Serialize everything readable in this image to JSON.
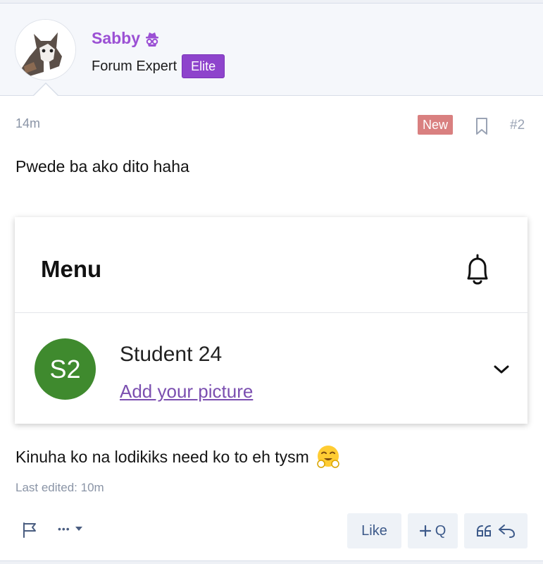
{
  "user": {
    "name": "Sabby",
    "title": "Forum Expert",
    "badge": "Elite",
    "avatar_icon": "cat-avatar",
    "name_icon": "incognito-icon"
  },
  "post": {
    "time": "14m",
    "new_label": "New",
    "post_number": "#2",
    "text1": "Pwede ba ako dito haha",
    "text2": "Kinuha ko na lodikiks need ko to eh tysm",
    "last_edited": "Last edited: 10m"
  },
  "screenshot": {
    "menu_title": "Menu",
    "avatar_initials": "S2",
    "student_name": "Student 24",
    "add_picture": "Add your picture"
  },
  "actions": {
    "like": "Like",
    "multiquote": "Q",
    "more": "•••"
  },
  "colors": {
    "username": "#9b50d4",
    "badge": "#8e44cc",
    "new_badge": "#d98080",
    "s2_avatar": "#3f8a2e",
    "action_text": "#3d5a8a"
  }
}
